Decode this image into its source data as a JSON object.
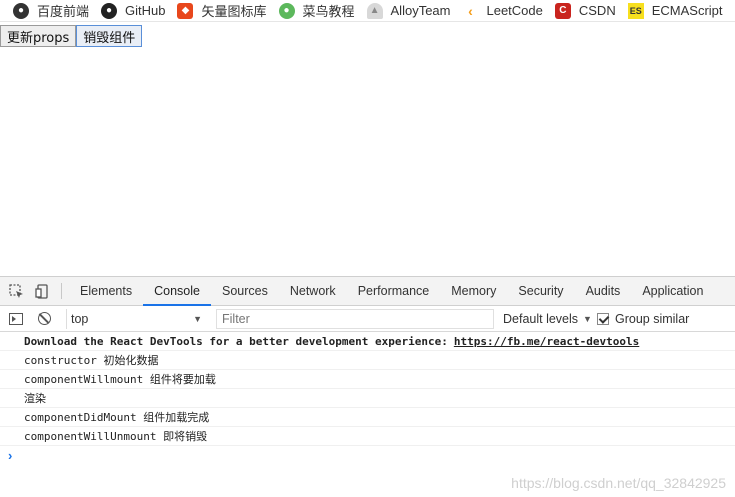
{
  "bookmarks": [
    {
      "label": "百度前端",
      "icon": "baidu-paw-icon",
      "glyph": "●"
    },
    {
      "label": "GitHub",
      "icon": "github-icon",
      "glyph": "●"
    },
    {
      "label": "矢量图标库",
      "icon": "iconfont-icon",
      "glyph": "◆"
    },
    {
      "label": "菜鸟教程",
      "icon": "runoob-icon",
      "glyph": "●"
    },
    {
      "label": "AlloyTeam",
      "icon": "alloyteam-icon",
      "glyph": "▲"
    },
    {
      "label": "LeetCode",
      "icon": "leetcode-icon",
      "glyph": "‹"
    },
    {
      "label": "CSDN",
      "icon": "csdn-icon",
      "glyph": "C"
    },
    {
      "label": "ECMAScript",
      "icon": "es-icon",
      "glyph": "ES"
    }
  ],
  "page": {
    "update_button": "更新props",
    "destroy_button": "销毁组件"
  },
  "devtools": {
    "tabs": [
      "Elements",
      "Console",
      "Sources",
      "Network",
      "Performance",
      "Memory",
      "Security",
      "Audits",
      "Application"
    ],
    "active_tab": "Console",
    "context": "top",
    "filter_placeholder": "Filter",
    "levels": "Default levels",
    "group_similar": "Group similar",
    "group_similar_checked": true
  },
  "console": {
    "devtools_notice": "Download the React DevTools for a better development experience:",
    "devtools_link": "https://fb.me/react-devtools",
    "logs": [
      "constructor 初始化数据",
      "componentWillmount 组件将要加载",
      "渲染",
      "componentDidMount 组件加载完成",
      "componentWillUnmount 即将销毁"
    ],
    "prompt": "›"
  },
  "watermark": "https://blog.csdn.net/qq_32842925"
}
